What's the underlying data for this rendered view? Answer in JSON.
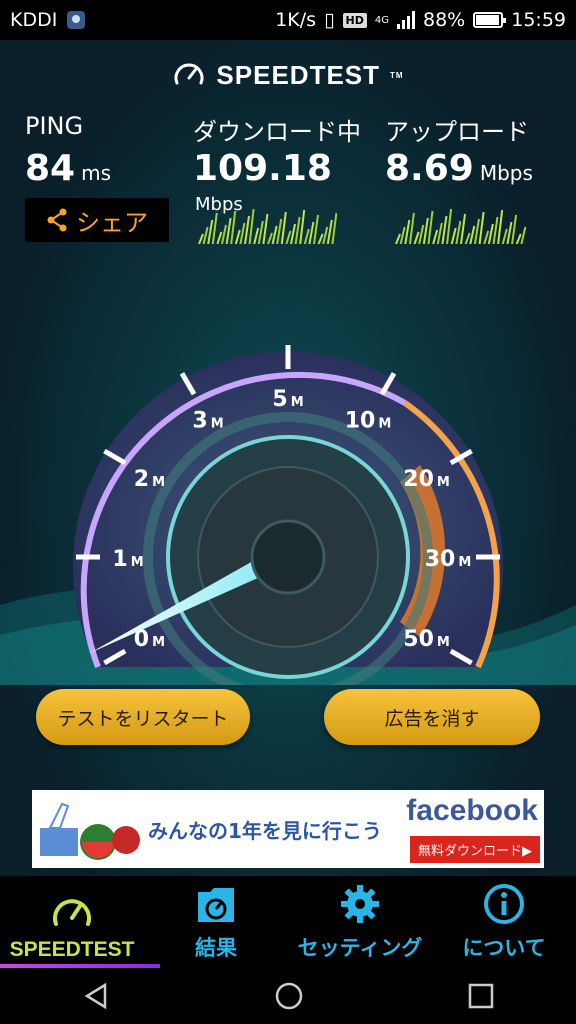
{
  "status_bar": {
    "carrier": "KDDI",
    "speed": "1K/s",
    "hd": "HD",
    "network": "4G",
    "battery": "88%",
    "time": "15:59"
  },
  "header": {
    "logo": "SPEEDTEST",
    "trademark": "TM"
  },
  "metrics": {
    "ping": {
      "label": "PING",
      "value": "84",
      "unit": "ms"
    },
    "download": {
      "label": "ダウンロード中",
      "value": "109.18",
      "unit": "Mbps"
    },
    "upload": {
      "label": "アップロード",
      "value": "8.69",
      "unit": "Mbps"
    }
  },
  "share": {
    "label": "シェア",
    "icon": "share-icon"
  },
  "gauge": {
    "ticks": [
      "0",
      "1",
      "2",
      "3",
      "5",
      "10",
      "20",
      "30",
      "50"
    ],
    "tick_unit": "M",
    "current_value": 109.18
  },
  "buttons": {
    "restart": "テストをリスタート",
    "remove_ads": "広告を消す"
  },
  "ad": {
    "text": "みんなの1年を見に行こう",
    "brand": "facebook",
    "cta": "無料ダウンロード▶"
  },
  "nav": {
    "items": [
      {
        "label": "SPEEDTEST",
        "icon": "speedometer-icon"
      },
      {
        "label": "結果",
        "icon": "results-folder-icon"
      },
      {
        "label": "セッティング",
        "icon": "gear-icon"
      },
      {
        "label": "について",
        "icon": "info-icon"
      }
    ]
  },
  "colors": {
    "accent_green": "#c7e34a",
    "accent_blue": "#2ab5e6",
    "button_gold": "#f6c33a",
    "gauge_purple": "#b089ff",
    "gauge_orange": "#f28a2e"
  }
}
